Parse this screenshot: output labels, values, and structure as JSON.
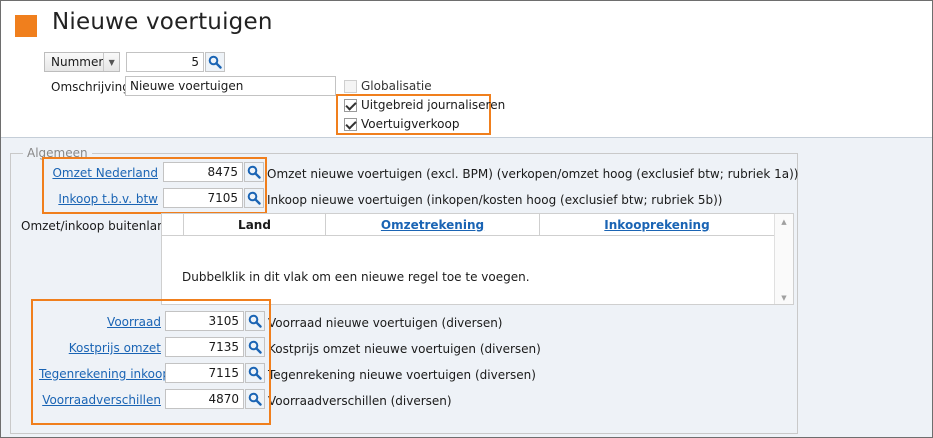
{
  "header": {
    "title": "Nieuwe voertuigen"
  },
  "selector": {
    "mode_label": "Nummer",
    "number_value": "5"
  },
  "description": {
    "label": "Omschrijving",
    "value": "Nieuwe voertuigen"
  },
  "options": {
    "globalisatie": {
      "label": "Globalisatie",
      "checked": false,
      "enabled": false
    },
    "uitgebreid": {
      "label": "Uitgebreid journaliseren",
      "checked": true
    },
    "voertuigverkoop": {
      "label": "Voertuigverkoop",
      "checked": true
    }
  },
  "group": {
    "title": "Algemeen"
  },
  "accounts_top": [
    {
      "label": "Omzet Nederland",
      "value": "8475",
      "description": "Omzet nieuwe voertuigen (excl. BPM) (verkopen/omzet hoog (exclusief btw; rubriek 1a))"
    },
    {
      "label": "Inkoop t.b.v. btw",
      "value": "7105",
      "description": "Inkoop nieuwe voertuigen (inkopen/kosten hoog (exclusief btw; rubriek 5b))"
    }
  ],
  "foreign": {
    "label": "Omzet/inkoop buitenland",
    "columns": [
      "Land",
      "Omzetrekening",
      "Inkooprekening"
    ],
    "empty_text": "Dubbelklik in dit vlak om een nieuwe regel toe te voegen."
  },
  "accounts_bottom": [
    {
      "label": "Voorraad",
      "value": "3105",
      "description": "Voorraad nieuwe voertuigen (diversen)"
    },
    {
      "label": "Kostprijs omzet",
      "value": "7135",
      "description": "Kostprijs omzet nieuwe voertuigen (diversen)"
    },
    {
      "label": "Tegenrekening inkoop",
      "value": "7115",
      "description": "Tegenrekening nieuwe voertuigen (diversen)"
    },
    {
      "label": "Voorraadverschillen",
      "value": "4870",
      "description": "Voorraadverschillen (diversen)"
    }
  ],
  "colors": {
    "accent": "#f07f1d",
    "link": "#1a64b4",
    "panel": "#eef2f7"
  },
  "icons": {
    "lookup": "search-icon",
    "brand": "orange-square-icon"
  }
}
